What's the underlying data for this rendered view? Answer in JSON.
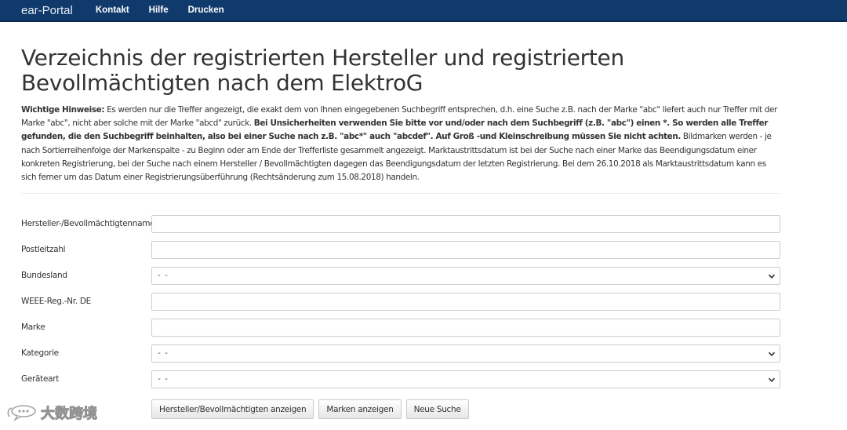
{
  "navbar": {
    "brand": "ear-Portal",
    "links": [
      "Kontakt",
      "Hilfe",
      "Drucken"
    ]
  },
  "page": {
    "title": "Verzeichnis der registrierten Hersteller und registrierten Bevollmächtigten nach dem ElektroG"
  },
  "notice": {
    "lead": "Wichtige Hinweise:",
    "part1": " Es werden nur die Treffer angezeigt, die exakt dem von Ihnen eingegebenen Suchbegriff entsprechen, d.h. eine Suche z.B. nach der Marke \"abc\" liefert auch nur Treffer mit der Marke \"abc\", nicht aber solche mit der Marke \"abcd\" zurück. ",
    "bold": "Bei Unsicherheiten verwenden Sie bitte vor und/oder nach dem Suchbegriff (z.B. \"abc\") einen *. So werden alle Treffer gefunden, die den Suchbegriff beinhalten, also bei einer Suche nach z.B. \"abc*\" auch \"abcdef\". Auf Groß -und Kleinschreibung müssen Sie nicht achten.",
    "part2": " Bildmarken werden - je nach Sortierreihenfolge der Markenspalte - zu Beginn oder am Ende der Trefferliste gesammelt angezeigt. Marktaustrittsdatum ist bei der Suche nach einer Marke das Beendigungsdatum einer konkreten Registrierung, bei der Suche nach einem Hersteller / Bevollmächtigten dagegen das Beendigungsdatum der letzten Registrierung. Bei dem 26.10.2018 als Marktaustrittsdatum kann es sich ferner um das Datum einer Registrierungsüberführung (Rechtsänderung zum 15.08.2018) handeln."
  },
  "form": {
    "fields": [
      {
        "label": "Hersteller-/Bevollmächtigtenname",
        "type": "input",
        "value": ""
      },
      {
        "label": "Postleitzahl",
        "type": "input",
        "value": ""
      },
      {
        "label": "Bundesland",
        "type": "select",
        "value": "- -"
      },
      {
        "label": "WEEE-Reg.-Nr. DE",
        "type": "input",
        "value": ""
      },
      {
        "label": "Marke",
        "type": "input",
        "value": ""
      },
      {
        "label": "Kategorie",
        "type": "select",
        "value": "- -"
      },
      {
        "label": "Geräteart",
        "type": "select",
        "value": "- -"
      }
    ],
    "buttons": [
      "Hersteller/Bevollmächtigten anzeigen",
      "Marken anzeigen",
      "Neue Suche"
    ]
  },
  "watermark": {
    "text": "大数跨境",
    "icon": "chat-bubble-logo-icon"
  },
  "colors": {
    "navbar_bg": "#113a6c",
    "text": "#333333",
    "input_border": "#cccccc"
  }
}
